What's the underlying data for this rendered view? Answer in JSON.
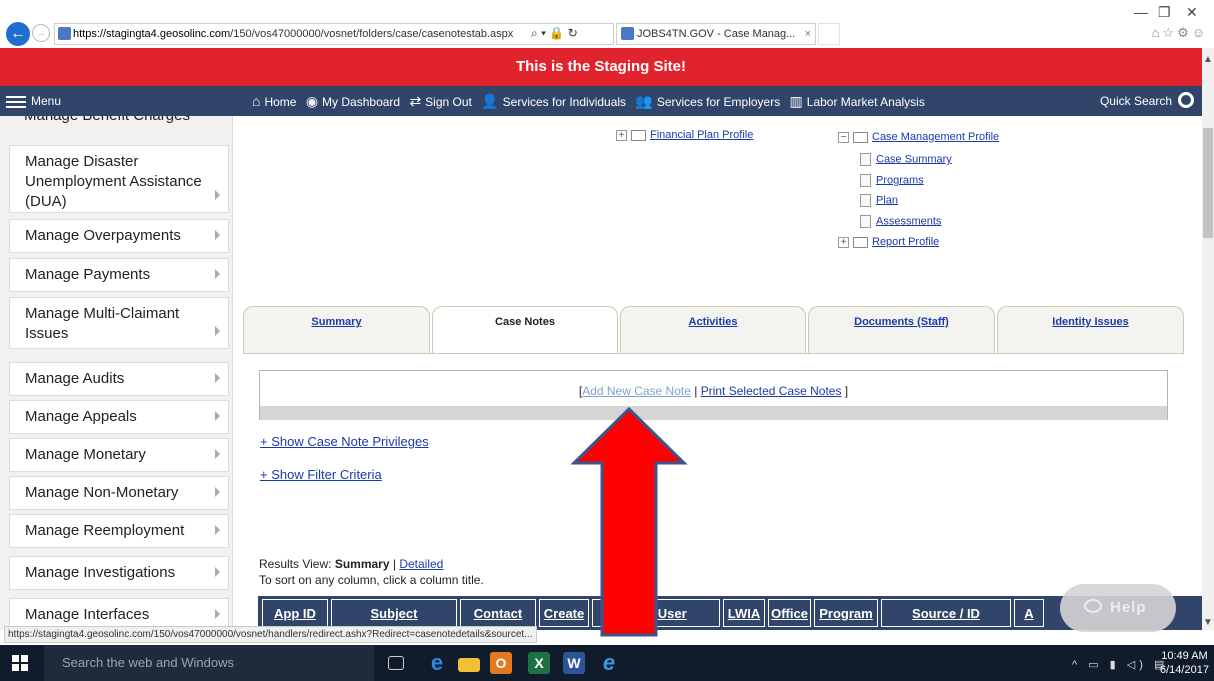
{
  "browser": {
    "url_host": "https://stagingta4.geosolinc.com",
    "url_path": "/150/vos47000000/vosnet/folders/case/casenotestab.aspx",
    "addr_tools": "⌕ ▾ 🔒 ↻",
    "tab_title": "JOBS4TN.GOV - Case Manag...",
    "tab_close": "×",
    "win_min": "—",
    "win_max": "❐",
    "win_close": "✕",
    "right_icons": "⌂☆⚙☺"
  },
  "banner": {
    "text": "This is the Staging Site!"
  },
  "navbar": {
    "menu_label": "Menu",
    "items": [
      {
        "icon": "⌂",
        "label": "Home"
      },
      {
        "icon": "◉",
        "label": "My Dashboard"
      },
      {
        "icon": "⇄",
        "label": "Sign Out"
      },
      {
        "icon": "👤",
        "label": "Services for Individuals"
      },
      {
        "icon": "👥",
        "label": "Services for Employers"
      },
      {
        "icon": "▥",
        "label": "Labor Market Analysis"
      }
    ],
    "quick_search": "Quick Search"
  },
  "sidebar": {
    "cut_item": "Manage Benefit Charges",
    "items": [
      "Manage Disaster Unemployment Assistance (DUA)",
      "Manage Overpayments",
      "Manage Payments",
      "Manage Multi-Claimant Issues",
      "Manage Audits",
      "Manage Appeals",
      "Manage Monetary",
      "Manage Non-Monetary",
      "Manage Reemployment",
      "Manage Investigations",
      "Manage Interfaces"
    ]
  },
  "tree": {
    "financial_plan": "Financial Plan Profile",
    "case_mgmt": "Case Management Profile",
    "case_summary": "Case Summary",
    "programs": "Programs",
    "plan": "Plan",
    "assessments": "Assessments",
    "report_profile": "Report Profile",
    "plus": "+",
    "minus": "−"
  },
  "tabs": [
    "Summary",
    "Case Notes",
    "Activities",
    "Documents (Staff)",
    "Identity Issues"
  ],
  "notes_actions": {
    "open_bracket": "[",
    "add_new": "Add New Case Note",
    "separator": " | ",
    "print_selected": "Print Selected Case Notes",
    "close_bracket": " ]"
  },
  "links": {
    "privileges": "+ Show Case Note Privileges",
    "filter": "+ Show Filter Criteria"
  },
  "results": {
    "prefix": "Results View: ",
    "summary": "Summary",
    "sep": " | ",
    "detailed": "Detailed",
    "sort_hint": "To sort on any column, click a column title."
  },
  "table_headers": [
    "App ID",
    "Subject",
    "Contact",
    "Create",
    "Staff User",
    "LWIA",
    "Office",
    "Program",
    "Source / ID",
    "A"
  ],
  "help": {
    "label": "Help"
  },
  "status_url": "https://stagingta4.geosolinc.com/150/vos47000000/vosnet/handlers/redirect.ashx?Redirect=casenotedetails&sourcet...",
  "taskbar": {
    "search_placeholder": "Search the web and Windows",
    "tray": "^ ▭ ▮ ◁) ▤",
    "time": "10:49 AM",
    "date": "6/14/2017"
  },
  "colors": {
    "banner_red": "#e0232c",
    "nav_blue": "#31456b",
    "arrow_red": "#ff0000",
    "arrow_outline": "#3a5590"
  }
}
